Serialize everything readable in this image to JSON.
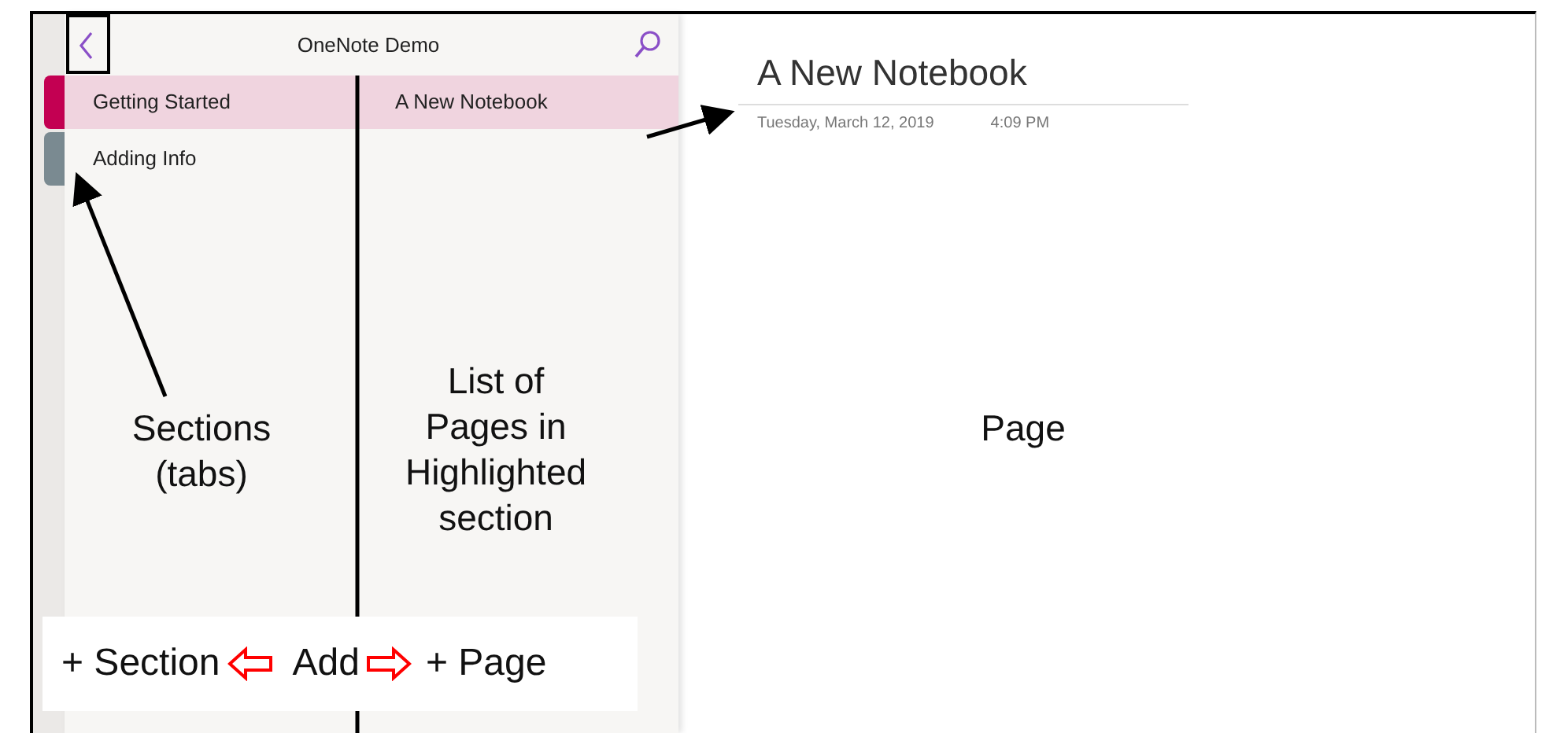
{
  "header": {
    "title": "OneNote Demo"
  },
  "sections": [
    {
      "label": "Getting Started",
      "selected": true,
      "color": "#c30052"
    },
    {
      "label": "Adding Info",
      "selected": false,
      "color": "#7a8a91"
    }
  ],
  "pages": [
    {
      "title": "A New Notebook",
      "selected": true
    }
  ],
  "page": {
    "title": "A New Notebook",
    "date": "Tuesday, March 12, 2019",
    "time": "4:09 PM"
  },
  "annotations": {
    "sections": "Sections\n(tabs)",
    "pages": "List of\nPages in\nHighlighted\nsection",
    "page": "Page"
  },
  "legend": {
    "section": "+ Section",
    "add": "Add",
    "page": "+ Page"
  }
}
